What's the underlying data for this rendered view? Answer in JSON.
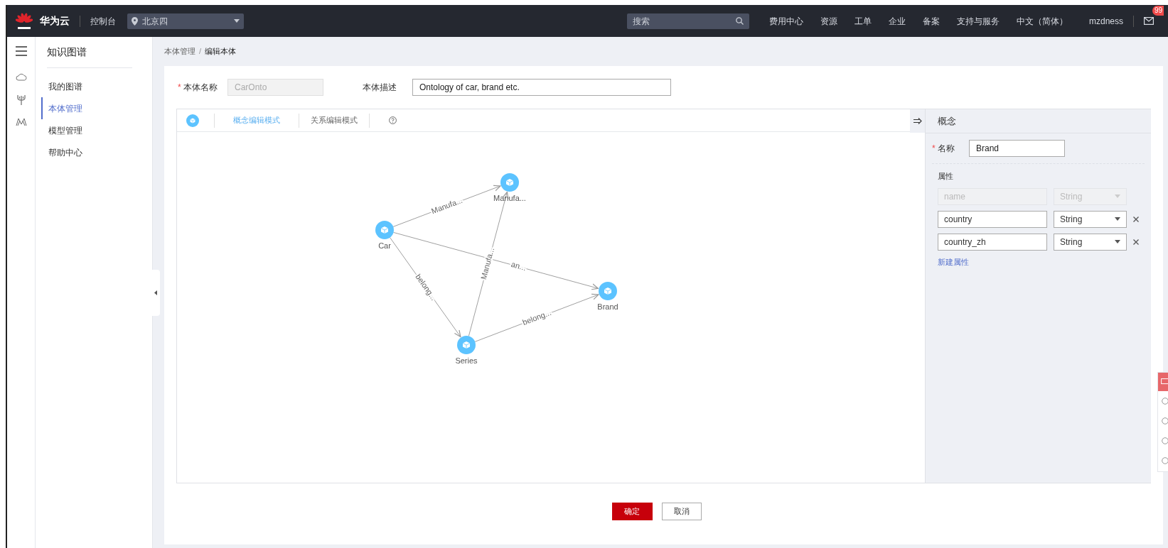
{
  "topbar": {
    "brand": "华为云",
    "console": "控制台",
    "region": "北京四",
    "search": {
      "placeholder": "搜索"
    },
    "links": [
      "费用中心",
      "资源",
      "工单",
      "企业",
      "备案",
      "支持与服务",
      "中文（简体）"
    ],
    "user": "mzdness",
    "badge": "99"
  },
  "sidebar": {
    "title": "知识图谱",
    "items": [
      {
        "label": "我的图谱",
        "selected": false
      },
      {
        "label": "本体管理",
        "selected": true
      },
      {
        "label": "模型管理",
        "selected": false
      },
      {
        "label": "帮助中心",
        "selected": false
      }
    ]
  },
  "breadcrumb": {
    "items": [
      "本体管理",
      "编辑本体"
    ],
    "separator": "/"
  },
  "form": {
    "name": {
      "label": "本体名称",
      "value": "CarOnto",
      "disabled": true,
      "required_mark": "*"
    },
    "description": {
      "label": "本体描述",
      "value": "Ontology of car, brand etc.",
      "disabled": false
    }
  },
  "toolbar": {
    "modes": [
      {
        "label": "概念编辑模式",
        "selected": true
      },
      {
        "label": "关系编辑模式",
        "selected": false
      }
    ]
  },
  "graph": {
    "nodes": [
      {
        "label": "Car"
      },
      {
        "label": "Manufa..."
      },
      {
        "label": "Brand"
      },
      {
        "label": "Series"
      }
    ],
    "edges": [
      {
        "label": "Manufa..."
      },
      {
        "label": "an..."
      },
      {
        "label": "belong..."
      },
      {
        "label": "Manufa..."
      },
      {
        "label": "belong..."
      }
    ]
  },
  "panel": {
    "title": "概念",
    "name_required_mark": "*",
    "name_label": "名称",
    "name_value": "Brand",
    "attributes_label": "属性",
    "attributes": [
      {
        "name": "name",
        "type": "String",
        "disabled": true
      },
      {
        "name": "country",
        "type": "String",
        "disabled": false
      },
      {
        "name": "country_zh",
        "type": "String",
        "disabled": false
      }
    ],
    "add_link": "新建属性"
  },
  "buttons": {
    "confirm": "确定",
    "cancel": "取消"
  }
}
